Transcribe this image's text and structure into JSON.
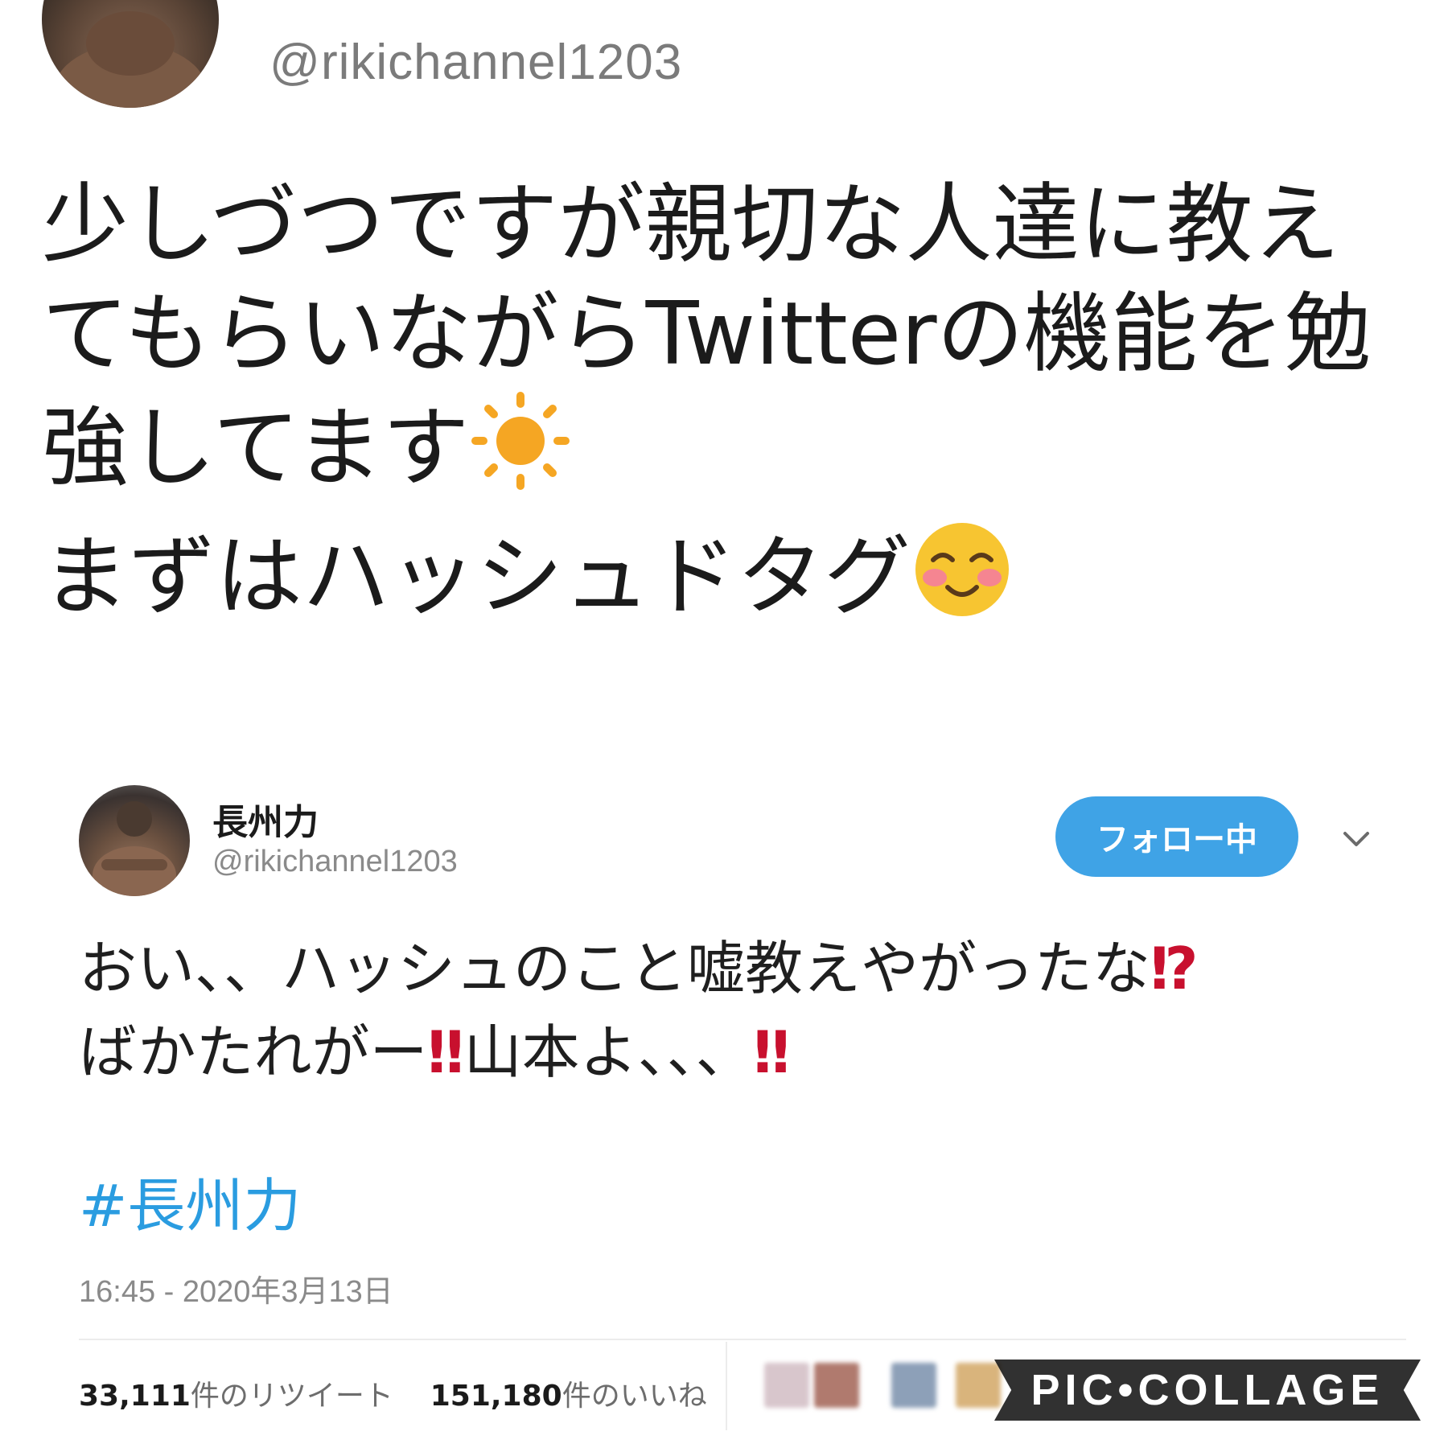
{
  "top_tweet": {
    "handle": "@rikichannel1203",
    "lines": [
      "少しづつですが親切な人達に教え",
      "てもらいながらTwitterの機能を勉",
      "強してます",
      "まずはハッシュドタグ"
    ],
    "emojis": [
      "sun-icon",
      "smiling-face-blush-icon"
    ]
  },
  "card": {
    "display_name": "長州力",
    "handle": "@rikichannel1203",
    "follow_label": "フォロー中",
    "line1_text": "おい、、ハッシュのこと嘘教えやがったな",
    "line1_mark": "⁉",
    "line2_part1": "ばかたれがー",
    "line2_mark1": "‼",
    "line2_part2": "山本よ、、、",
    "line2_mark2": "‼",
    "hashtag": "#長州力",
    "timestamp": "16:45 - 2020年3月13日",
    "retweets_count": "33,111",
    "retweets_label": "件のリツイート",
    "likes_count": "151,180",
    "likes_label": "件のいいね"
  },
  "watermark": "PIC•COLLAGE",
  "colors": {
    "follow_button": "#3fa3e6",
    "hashtag": "#2a9ce0",
    "exclamation": "#c8102e",
    "secondary_text": "#8a8a8a"
  }
}
